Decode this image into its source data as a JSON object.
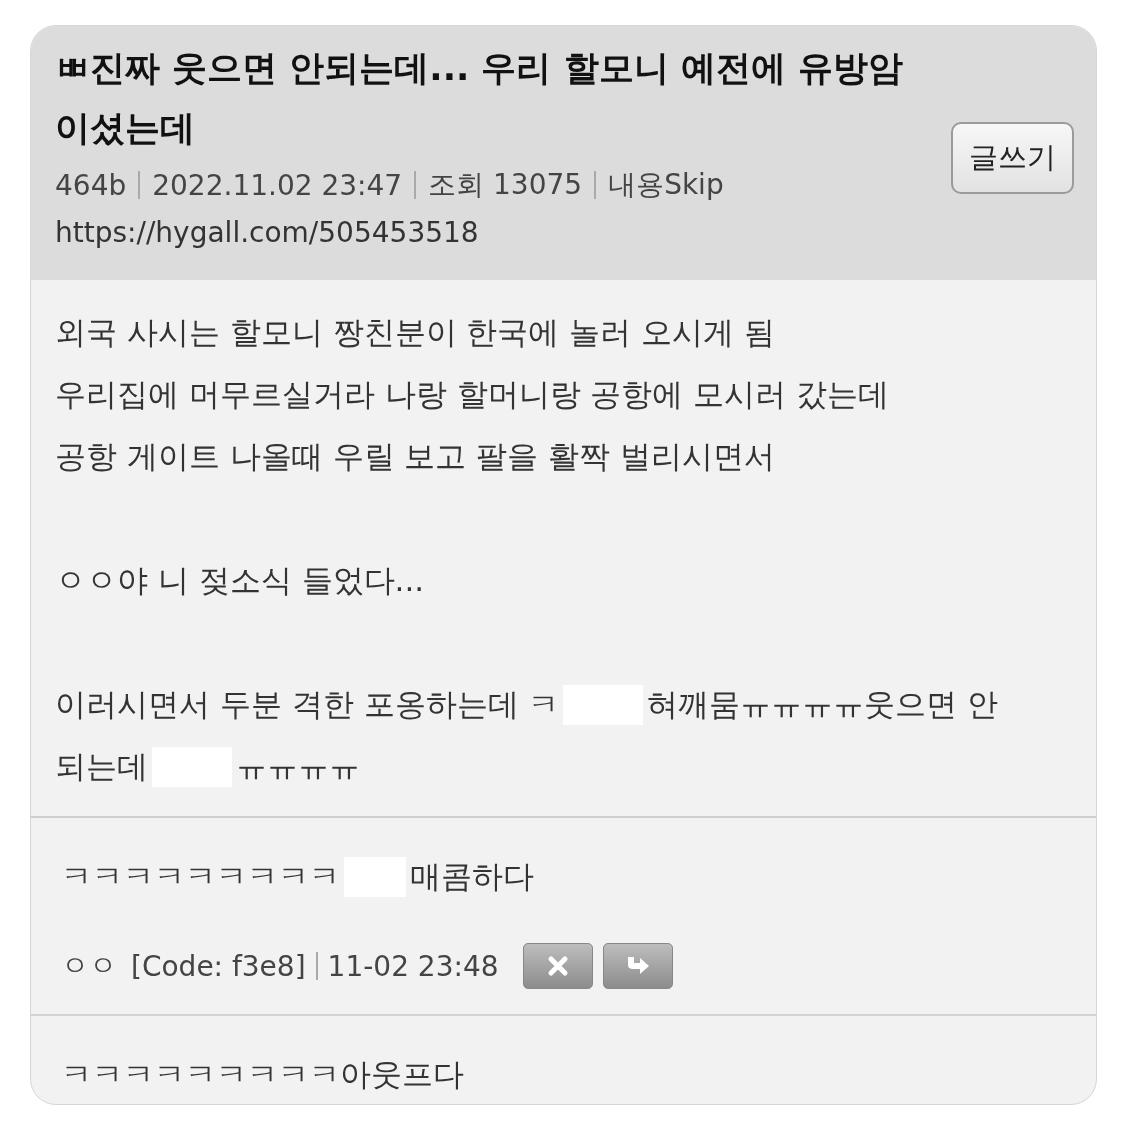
{
  "post": {
    "title_lines": [
      "ㅃ진짜 웃으면 안되는데... 우리 할모니 예전에 유방암",
      "이셨는데"
    ],
    "write_button": "글쓰기",
    "meta": [
      "464b",
      "2022.11.02 23:47",
      "조회 13075",
      "내용Skip"
    ],
    "url": "https://hygall.com/505453518",
    "body": [
      [
        [
          {
            "kind": "text",
            "text": "외국 사시는 할모니 짱친분이 한국에 놀러 오시게 됨"
          }
        ],
        [
          {
            "kind": "text",
            "text": "우리집에 머무르실거라 나랑 할머니랑 공항에 모시러 갔는데"
          }
        ],
        [
          {
            "kind": "text",
            "text": "공항 게이트 나올때 우릴 보고 팔을 활짝 벌리시면서"
          }
        ]
      ],
      [
        [
          {
            "kind": "text",
            "text": "ㅇㅇ야 니 젖소식 들었다..."
          }
        ]
      ],
      [
        [
          {
            "kind": "text",
            "text": "이러시면서 두분 격한 포옹하는데 ㅋ"
          },
          {
            "kind": "redaction"
          },
          {
            "kind": "text",
            "text": "혀깨뭄ㅠㅠㅠㅠ웃으면 안"
          }
        ],
        [
          {
            "kind": "text",
            "text": "되는데"
          },
          {
            "kind": "redaction"
          },
          {
            "kind": "text",
            "text": "ㅠㅠㅠㅠ"
          }
        ]
      ]
    ]
  },
  "comments": [
    {
      "segments": [
        {
          "kind": "text",
          "text": "ㅋㅋㅋㅋㅋㅋㅋㅋㅋ"
        },
        {
          "kind": "redaction"
        },
        {
          "kind": "text",
          "text": "매콤하다"
        }
      ],
      "author": "ㅇㅇ",
      "code": "[Code: f3e8]",
      "time": "11-02 23:48",
      "actions": [
        {
          "kind": "delete"
        },
        {
          "kind": "reply"
        }
      ]
    },
    {
      "segments": [
        {
          "kind": "text",
          "text": "ㅋㅋㅋㅋㅋㅋㅋㅋㅋ아웃프다"
        }
      ]
    }
  ]
}
